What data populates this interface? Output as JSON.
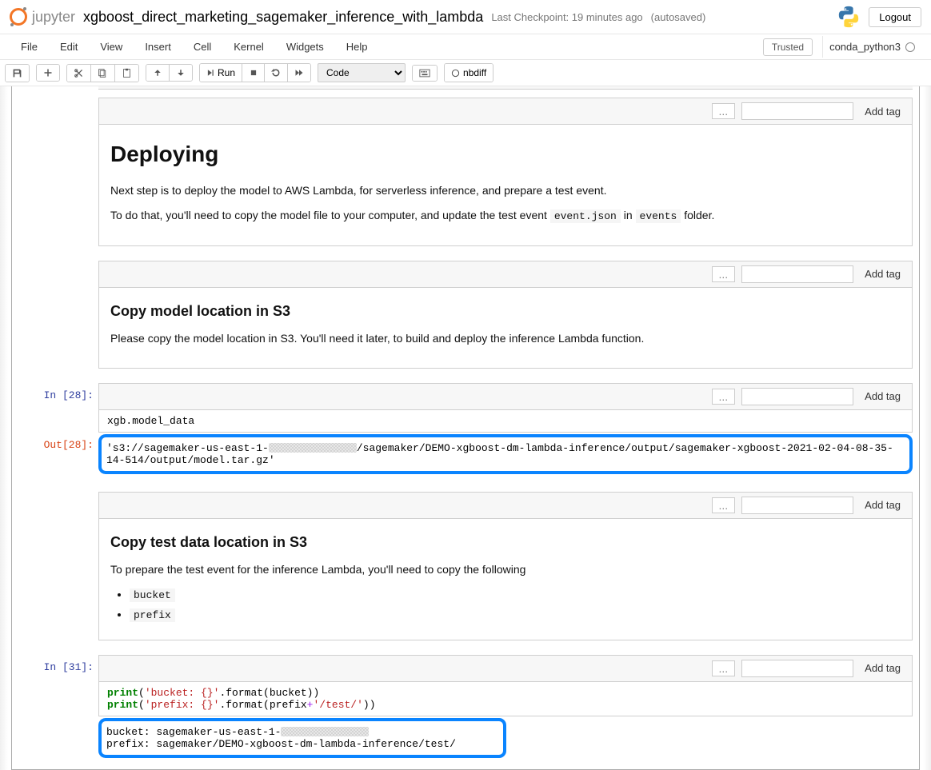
{
  "header": {
    "logo_text": "jupyter",
    "notebook_name": "xgboost_direct_marketing_sagemaker_inference_with_lambda",
    "checkpoint": "Last Checkpoint: 19 minutes ago",
    "autosave": "(autosaved)",
    "logout": "Logout"
  },
  "menubar": {
    "items": [
      "File",
      "Edit",
      "View",
      "Insert",
      "Cell",
      "Kernel",
      "Widgets",
      "Help"
    ],
    "trusted": "Trusted",
    "kernel": "conda_python3"
  },
  "toolbar": {
    "run_label": "Run",
    "cell_type": "Code",
    "nbdiff": "nbdiff"
  },
  "cells": {
    "deploy_md": {
      "title": "Deploying",
      "p1": "Next step is to deploy the model to AWS Lambda, for serverless inference, and prepare a test event.",
      "p2a": "To do that, you'll need to copy the model file to your computer, and update the test event ",
      "code1": "event.json",
      "p2b": " in ",
      "code2": "events",
      "p2c": " folder."
    },
    "copy_model_md": {
      "title": "Copy model location in S3",
      "p1": "Please copy the model location in S3. You'll need it later, to build and deploy the inference Lambda function."
    },
    "code28": {
      "in_prompt": "In [28]:",
      "out_prompt": "Out[28]:",
      "input": "xgb.model_data",
      "output_pre": "'s3://sagemaker-us-east-1-",
      "output_post": "/sagemaker/DEMO-xgboost-dm-lambda-inference/output/sagemaker-xgboost-2021-02-04-08-35-14-514/output/model.tar.gz'"
    },
    "copy_test_md": {
      "title": "Copy test data location in S3",
      "p1": "To prepare the test event for the inference Lambda, you'll need to copy the following",
      "li1": "bucket",
      "li2": "prefix"
    },
    "code31": {
      "in_prompt": "In [31]:",
      "line1_a": "print",
      "line1_b": "(",
      "line1_c": "'bucket: {}'",
      "line1_d": ".format(bucket))",
      "line2_a": "print",
      "line2_b": "(",
      "line2_c": "'prefix: {}'",
      "line2_d": ".format(prefix",
      "line2_e": "+",
      "line2_f": "'/test/'",
      "line2_g": "))",
      "out_l1_pre": "bucket: sagemaker-us-east-1-",
      "out_l2": "prefix: sagemaker/DEMO-xgboost-dm-lambda-inference/test/"
    },
    "tag_controls": {
      "dots": "...",
      "add_tag": "Add tag"
    }
  }
}
